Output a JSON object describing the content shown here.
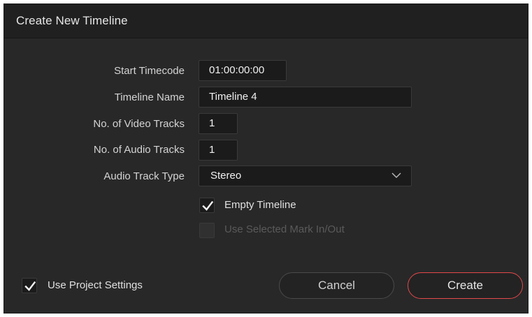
{
  "dialog": {
    "title": "Create New Timeline"
  },
  "form": {
    "start_timecode": {
      "label": "Start Timecode",
      "value": "01:00:00:00"
    },
    "timeline_name": {
      "label": "Timeline Name",
      "value": "Timeline 4"
    },
    "video_tracks": {
      "label": "No. of Video Tracks",
      "value": "1"
    },
    "audio_tracks": {
      "label": "No. of Audio Tracks",
      "value": "1"
    },
    "audio_track_type": {
      "label": "Audio Track Type",
      "value": "Stereo"
    }
  },
  "options": {
    "empty_timeline": {
      "label": "Empty Timeline",
      "checked": true
    },
    "use_selected_mark": {
      "label": "Use Selected Mark In/Out",
      "checked": false,
      "disabled": true
    },
    "use_project_settings": {
      "label": "Use Project Settings",
      "checked": true
    }
  },
  "buttons": {
    "cancel": "Cancel",
    "create": "Create"
  },
  "colors": {
    "dialog_bg": "#282828",
    "titlebar_bg": "#202020",
    "field_bg": "#1b1b1b",
    "accent": "#e4484a"
  },
  "icons": {
    "dropdown": "chevron-down-icon",
    "check": "checkmark-icon"
  }
}
